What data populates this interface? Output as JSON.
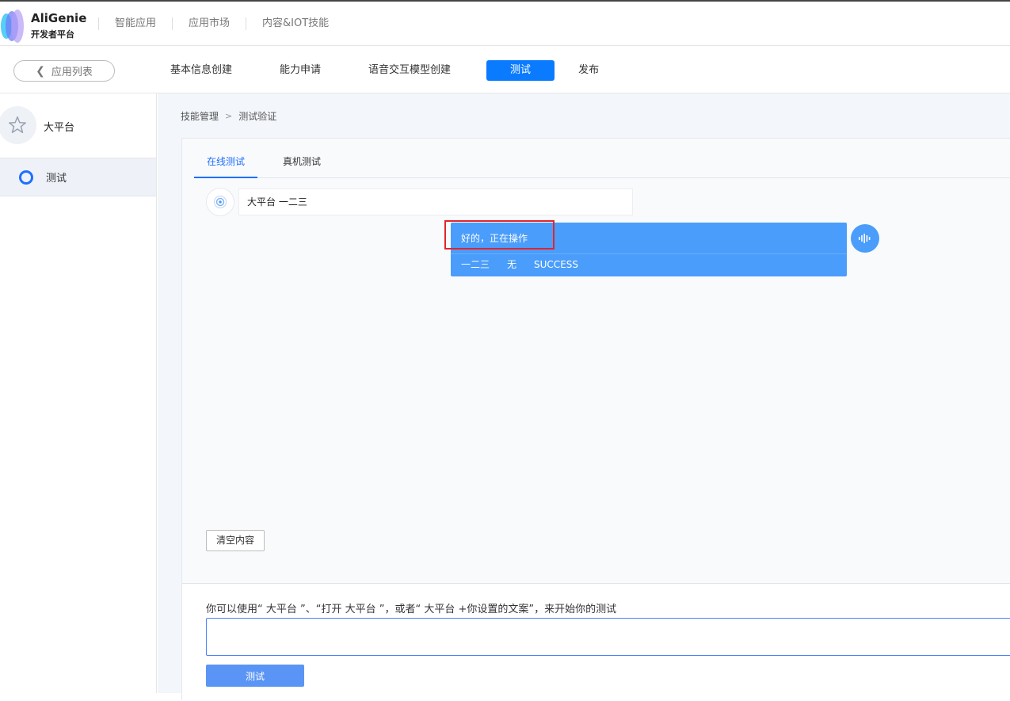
{
  "brand": {
    "name": "AliGenie",
    "subtitle": "开发者平台"
  },
  "topnav": [
    {
      "label": "智能应用"
    },
    {
      "label": "应用市场"
    },
    {
      "label": "内容&IOT技能"
    }
  ],
  "subbar": {
    "back_label": "应用列表",
    "steps": [
      {
        "label": "基本信息创建"
      },
      {
        "label": "能力申请"
      },
      {
        "label": "语音交互模型创建"
      },
      {
        "label": "测试"
      },
      {
        "label": "发布"
      }
    ],
    "active_step": "测试"
  },
  "sidebar": {
    "title": "大平台",
    "items": [
      {
        "label": "测试"
      }
    ]
  },
  "breadcrumb": {
    "items": [
      "技能管理",
      "测试验证"
    ]
  },
  "tabs": [
    {
      "label": "在线测试"
    },
    {
      "label": "真机测试"
    }
  ],
  "conversation": {
    "user_message": "大平台 一二三",
    "bot_reply": "好的，正在操作",
    "bot_details": [
      "一二三",
      "无",
      "SUCCESS"
    ]
  },
  "actions": {
    "clear_label": "清空内容",
    "hint": "你可以使用“ 大平台 ”、“打开 大平台 ”，或者“ 大平台 +你设置的文案”，来开始你的测试",
    "input_value": "",
    "submit_label": "测试"
  },
  "colors": {
    "primary": "#0a7bff",
    "bot_bubble": "#4a9dfa",
    "highlight_box": "#e3252b",
    "submit_button": "#5a95f5"
  }
}
